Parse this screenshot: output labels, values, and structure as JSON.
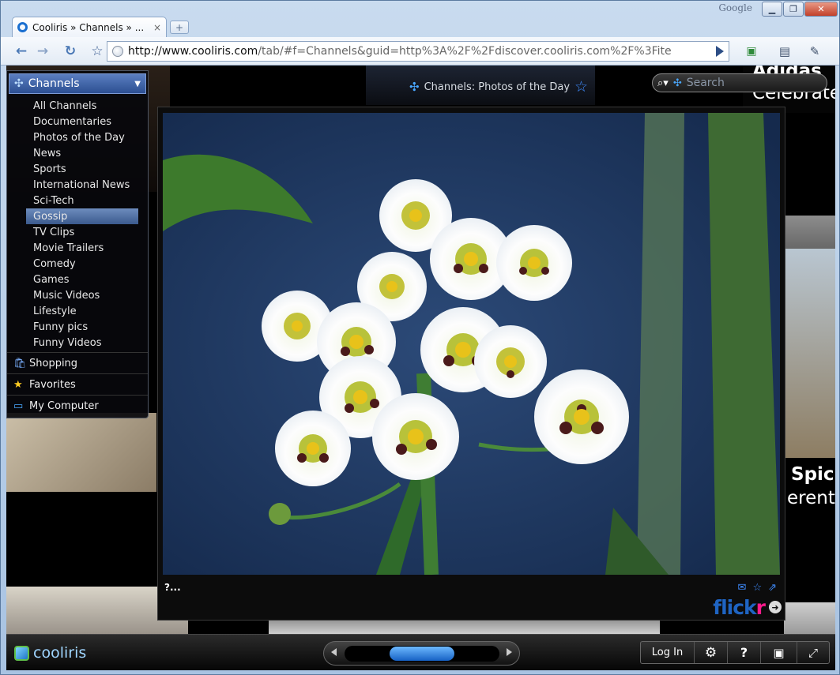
{
  "window": {
    "brand_label": "Google",
    "minimize_label": "▁",
    "maximize_label": "❐",
    "close_label": "✕"
  },
  "tab": {
    "title": "Cooliris » Channels » ...",
    "close_label": "×",
    "new_tab_label": "+"
  },
  "toolbar": {
    "url_host": "http://www.cooliris.com",
    "url_rest": "/tab/#f=Channels&guid=http%3A%2F%2Fdiscover.cooliris.com%2F%3Fite"
  },
  "header": {
    "title": "Channels: Photos of the Day"
  },
  "search": {
    "placeholder": "Search"
  },
  "sidebar": {
    "title": "Channels",
    "items": [
      {
        "label": "All Channels"
      },
      {
        "label": "Documentaries"
      },
      {
        "label": "Photos of the Day"
      },
      {
        "label": "News"
      },
      {
        "label": "Sports"
      },
      {
        "label": "International News"
      },
      {
        "label": "Sci-Tech"
      },
      {
        "label": "Gossip",
        "selected": true
      },
      {
        "label": "TV Clips"
      },
      {
        "label": "Movie Trailers"
      },
      {
        "label": "Comedy"
      },
      {
        "label": "Games"
      },
      {
        "label": "Music Videos"
      },
      {
        "label": "Lifestyle"
      },
      {
        "label": "Funny pics"
      },
      {
        "label": "Funny Videos"
      }
    ],
    "sections": [
      {
        "label": "Shopping",
        "icon": "shopping-bag-icon"
      },
      {
        "label": "Favorites",
        "icon": "star-icon"
      },
      {
        "label": "My Computer",
        "icon": "monitor-icon"
      }
    ]
  },
  "viewer": {
    "caption": "?...",
    "source_logo_a": "flick",
    "source_logo_b": "r"
  },
  "background_tiles": {
    "top_right_title": "Adidas",
    "top_right_sub": "Celebrate",
    "mid_right_title": "Spic",
    "mid_right_sub": "erent"
  },
  "bottombar": {
    "logo_text": "cooliris",
    "login_label": "Log In",
    "help_label": "?"
  },
  "colors": {
    "accent": "#3f8cff",
    "selected_item": "#4a6aa0",
    "flickr_blue": "#1f64c2",
    "flickr_pink": "#ff1a8c"
  }
}
